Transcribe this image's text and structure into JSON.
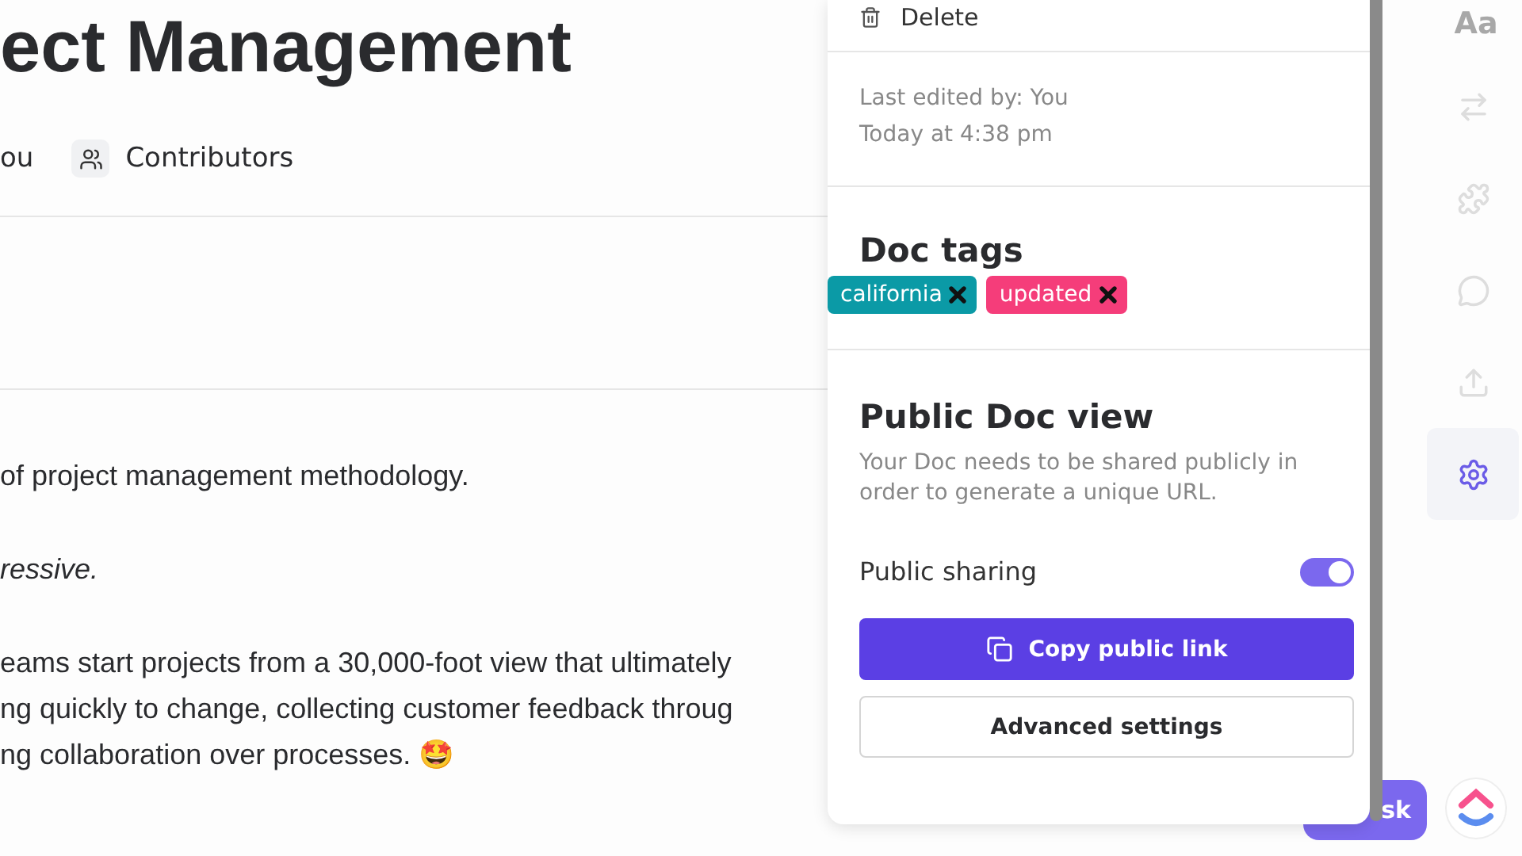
{
  "doc": {
    "title": "ect Management",
    "meta": [
      {
        "kind": "text",
        "label": "ou"
      },
      {
        "kind": "icon",
        "label": "Contributors"
      }
    ],
    "paragraphs": [
      {
        "kind": "plain",
        "text": "of project management methodology."
      },
      {
        "kind": "emphasis",
        "text": "ressive."
      },
      {
        "kind": "plain",
        "text": "eams start projects from a 30,000-foot view that ultimately"
      },
      {
        "kind": "plain",
        "text": "ng quickly to change, collecting customer feedback throug"
      },
      {
        "kind": "plain",
        "text": "ng collaboration over processes. 🤩"
      }
    ]
  },
  "panel": {
    "delete": "Delete",
    "last_edited": "Last edited by: You",
    "edited_time": "Today at 4:38 pm",
    "tags_title": "Doc tags",
    "tags": [
      {
        "label": "california",
        "color": "#0b9aa6"
      },
      {
        "label": "updated",
        "color": "#f53d7a"
      }
    ],
    "public_title": "Public Doc view",
    "public_desc": "Your Doc needs to be shared publicly in order to generate a unique URL.",
    "sharing_label": "Public sharing",
    "sharing_on": true,
    "copy_button": "Copy public link",
    "advanced_button": "Advanced settings"
  },
  "rail": {
    "font_label": "Aa",
    "items": [
      {
        "kind": "arrows",
        "selected": false
      },
      {
        "kind": "puzzle",
        "selected": false
      },
      {
        "kind": "chat",
        "selected": false
      },
      {
        "kind": "upload",
        "selected": false
      },
      {
        "kind": "gear",
        "selected": true
      }
    ]
  },
  "task_button": "sk"
}
